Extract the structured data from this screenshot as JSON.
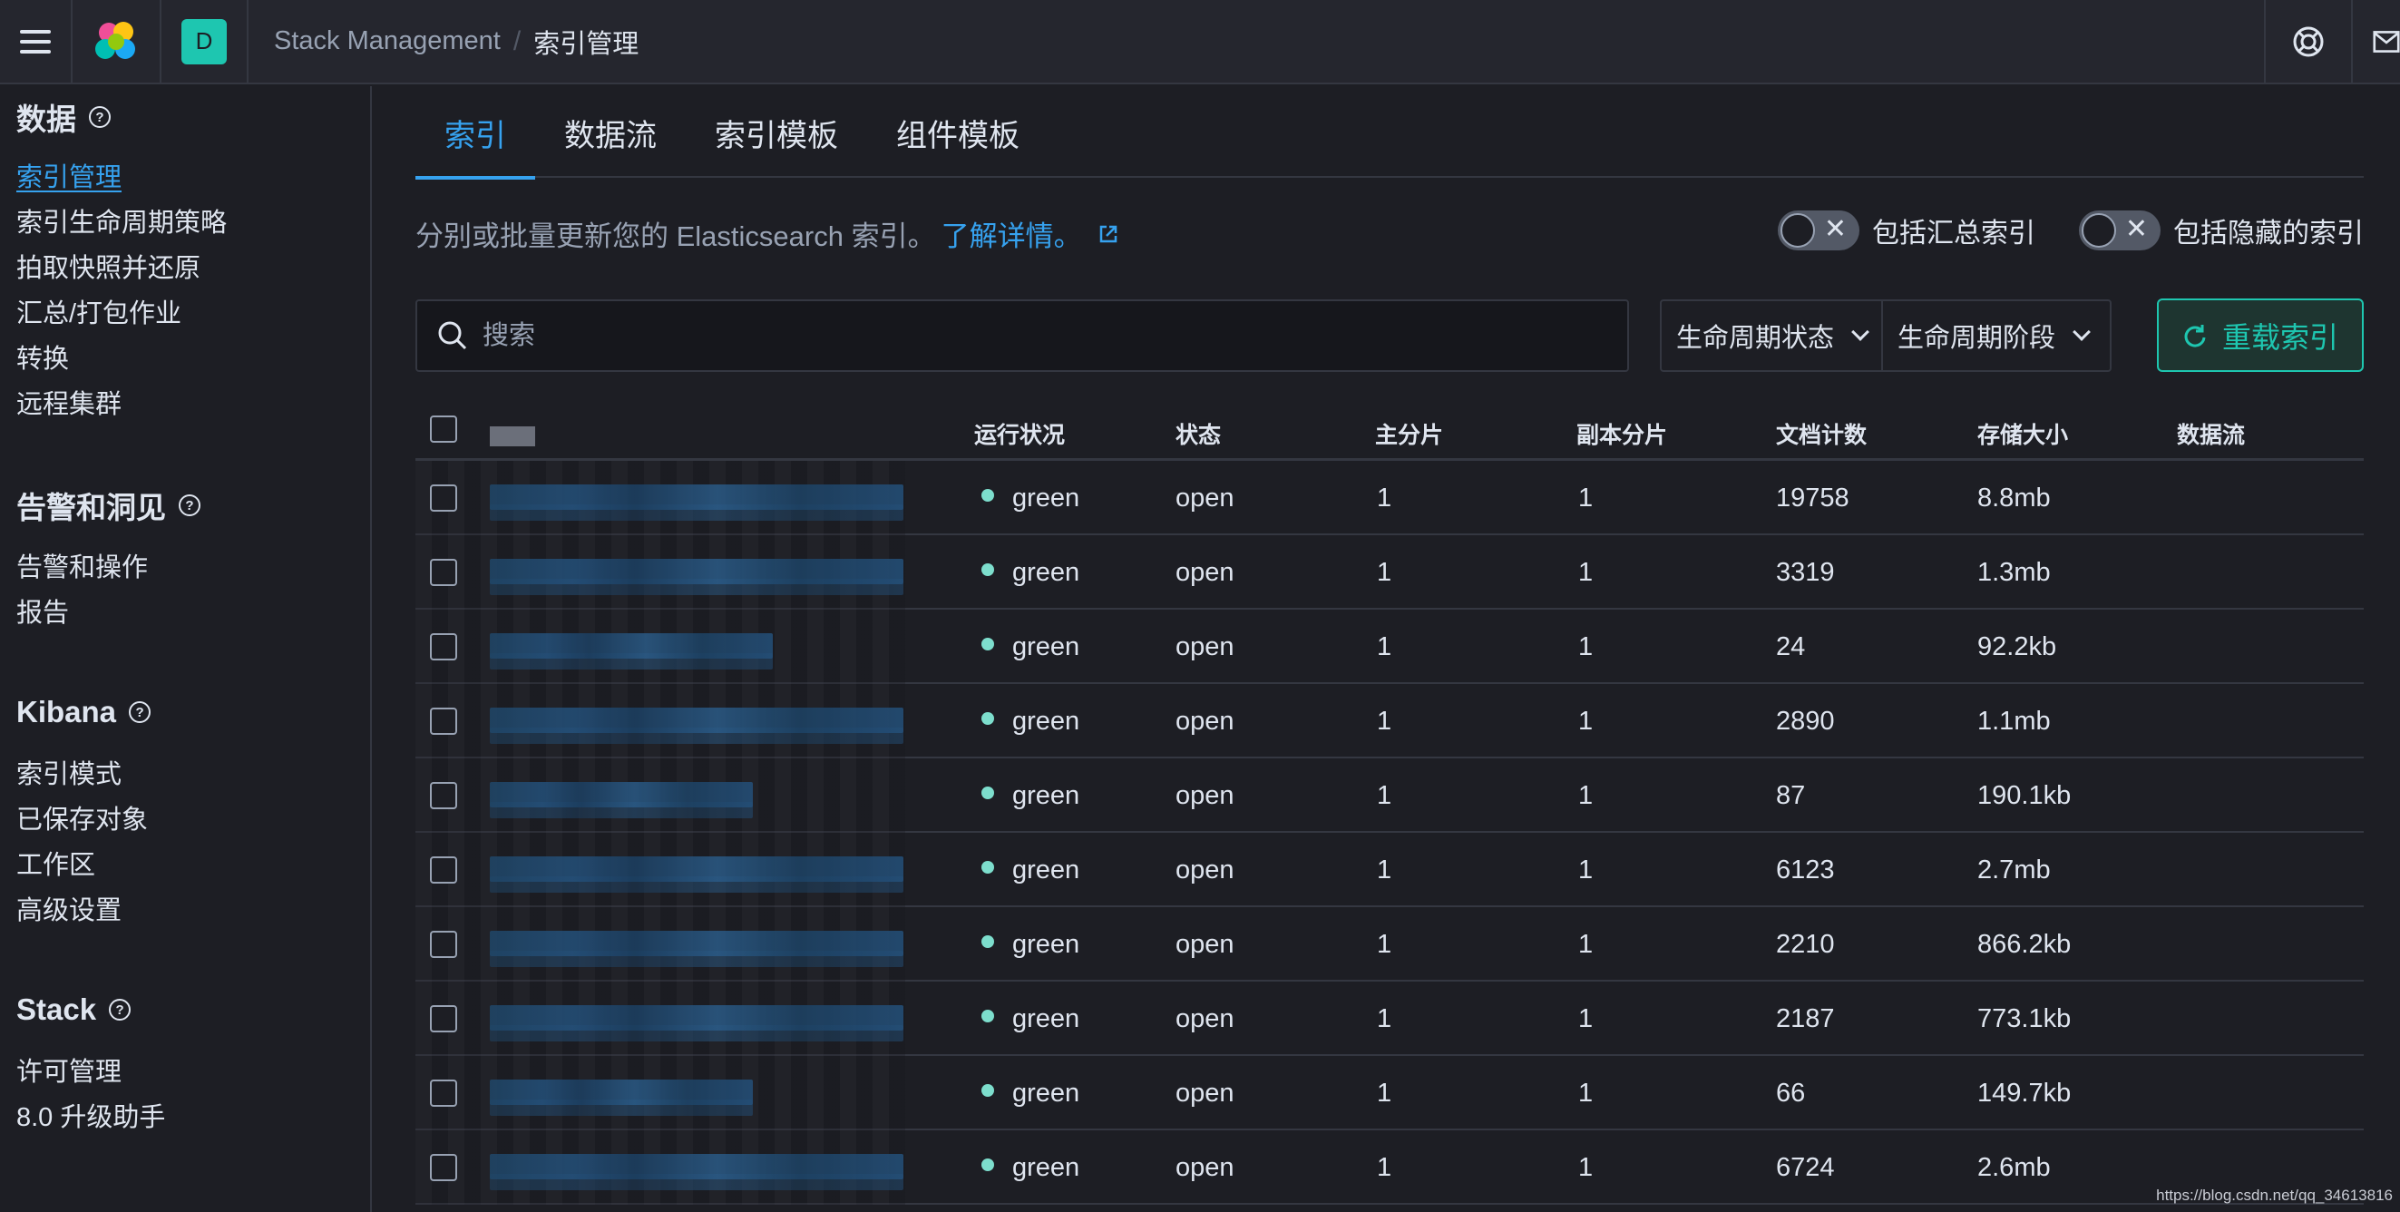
{
  "header": {
    "space_initial": "D",
    "breadcrumbs": {
      "parent": "Stack Management",
      "separator": "/",
      "current": "索引管理"
    }
  },
  "sidebar": {
    "groups": [
      {
        "title": "数据",
        "items": [
          "索引管理",
          "索引生命周期策略",
          "拍取快照并还原",
          "汇总/打包作业",
          "转换",
          "远程集群"
        ]
      },
      {
        "title": "告警和洞见",
        "items": [
          "告警和操作",
          "报告"
        ]
      },
      {
        "title": "Kibana",
        "items": [
          "索引模式",
          "已保存对象",
          "工作区",
          "高级设置"
        ]
      },
      {
        "title": "Stack",
        "items": [
          "许可管理",
          "8.0 升级助手"
        ]
      }
    ],
    "help_glyph": "?"
  },
  "tabs": [
    "索引",
    "数据流",
    "索引模板",
    "组件模板"
  ],
  "description": {
    "text": "分别或批量更新您的 Elasticsearch 索引。",
    "link": "了解详情。"
  },
  "toggles": [
    {
      "label": "包括汇总索引",
      "state": "off"
    },
    {
      "label": "包括隐藏的索引",
      "state": "off"
    }
  ],
  "search": {
    "placeholder": "搜索"
  },
  "filters": [
    "生命周期状态",
    "生命周期阶段"
  ],
  "reload_label": "重载索引",
  "table": {
    "columns": [
      "运行状况",
      "状态",
      "主分片",
      "副本分片",
      "文档计数",
      "存储大小",
      "数据流"
    ],
    "rows": [
      {
        "health": "green",
        "status": "open",
        "primary": "1",
        "replica": "1",
        "docs": "19758",
        "size": "8.8mb"
      },
      {
        "health": "green",
        "status": "open",
        "primary": "1",
        "replica": "1",
        "docs": "3319",
        "size": "1.3mb"
      },
      {
        "health": "green",
        "status": "open",
        "primary": "1",
        "replica": "1",
        "docs": "24",
        "size": "92.2kb"
      },
      {
        "health": "green",
        "status": "open",
        "primary": "1",
        "replica": "1",
        "docs": "2890",
        "size": "1.1mb"
      },
      {
        "health": "green",
        "status": "open",
        "primary": "1",
        "replica": "1",
        "docs": "87",
        "size": "190.1kb"
      },
      {
        "health": "green",
        "status": "open",
        "primary": "1",
        "replica": "1",
        "docs": "6123",
        "size": "2.7mb"
      },
      {
        "health": "green",
        "status": "open",
        "primary": "1",
        "replica": "1",
        "docs": "2210",
        "size": "866.2kb"
      },
      {
        "health": "green",
        "status": "open",
        "primary": "1",
        "replica": "1",
        "docs": "2187",
        "size": "773.1kb"
      },
      {
        "health": "green",
        "status": "open",
        "primary": "1",
        "replica": "1",
        "docs": "66",
        "size": "149.7kb"
      },
      {
        "health": "green",
        "status": "open",
        "primary": "1",
        "replica": "1",
        "docs": "6724",
        "size": "2.6mb"
      }
    ]
  },
  "watermark": "https://blog.csdn.net/qq_34613816",
  "colors": {
    "accent": "#36a2ef",
    "success": "#1ec6b0",
    "health_green": "#7ddecd",
    "background": "#1d1e24",
    "header": "#25262e"
  }
}
